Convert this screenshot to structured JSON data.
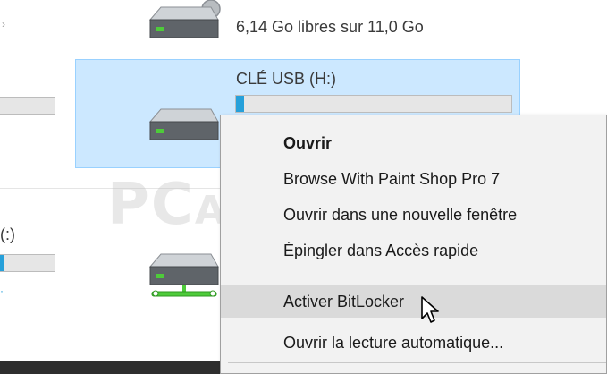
{
  "drives": {
    "top_drive": {
      "free_text": "6,14 Go libres sur 11,0 Go",
      "icon": "hard-drive-icon"
    },
    "usb_drive": {
      "label": "CLÉ USB (H:)",
      "usage_fraction": 0.03,
      "icon": "usb-drive-icon"
    },
    "left_drive_partial": {
      "label": "(:)",
      "usage_fraction": 0.08
    },
    "network_drive": {
      "icon": "network-drive-icon"
    }
  },
  "context_menu": {
    "items": [
      {
        "label": "Ouvrir",
        "bold": true
      },
      {
        "label": "Browse With Paint Shop Pro 7"
      },
      {
        "label": "Ouvrir dans une nouvelle fenêtre"
      },
      {
        "label": "Épingler dans Accès rapide"
      },
      {
        "label": "Activer BitLocker",
        "highlighted": true
      },
      {
        "label": "Ouvrir la lecture automatique..."
      }
    ]
  },
  "watermark": {
    "text_large": "PC",
    "text_small": "ASTUCES"
  },
  "colors": {
    "selection_fill": "#cce8ff",
    "selection_border": "#99d1ff",
    "usage_fill": "#26a0da",
    "menu_background": "#f2f2f2",
    "menu_hover": "#dadada"
  }
}
